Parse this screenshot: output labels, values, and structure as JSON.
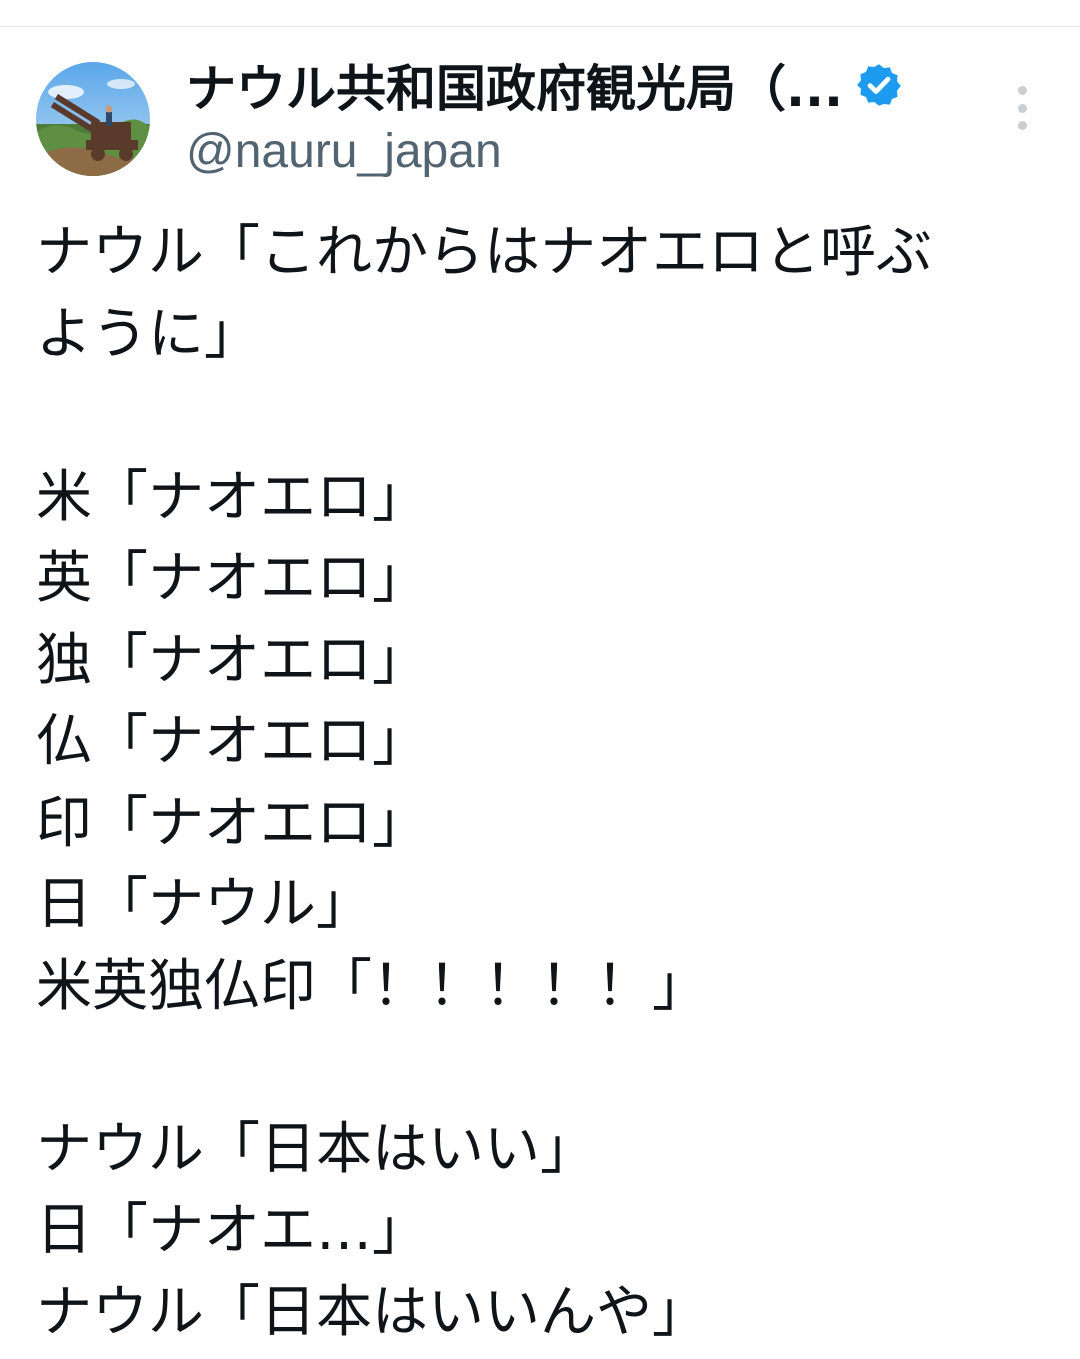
{
  "tweet": {
    "author": {
      "display_name": "ナウル共和国政府観光局（...",
      "handle": "@nauru_japan",
      "verified": true,
      "avatar_icon": "avatar-anti-aircraft-gun-photo"
    },
    "more_icon": "more-options-icon",
    "accent_color": "#1d9bf0",
    "text_lines": [
      "ナウル「これからはナオエロと呼ぶ",
      "ように」",
      "",
      "米「ナオエロ」",
      "英「ナオエロ」",
      "独「ナオエロ」",
      "仏「ナオエロ」",
      "印「ナオエロ」",
      "日「ナウル」",
      "米英独仏印「！！！！！」",
      "",
      "ナウル「日本はいい」",
      "日「ナオエ…」",
      "ナウル「日本はいいんや」"
    ]
  }
}
